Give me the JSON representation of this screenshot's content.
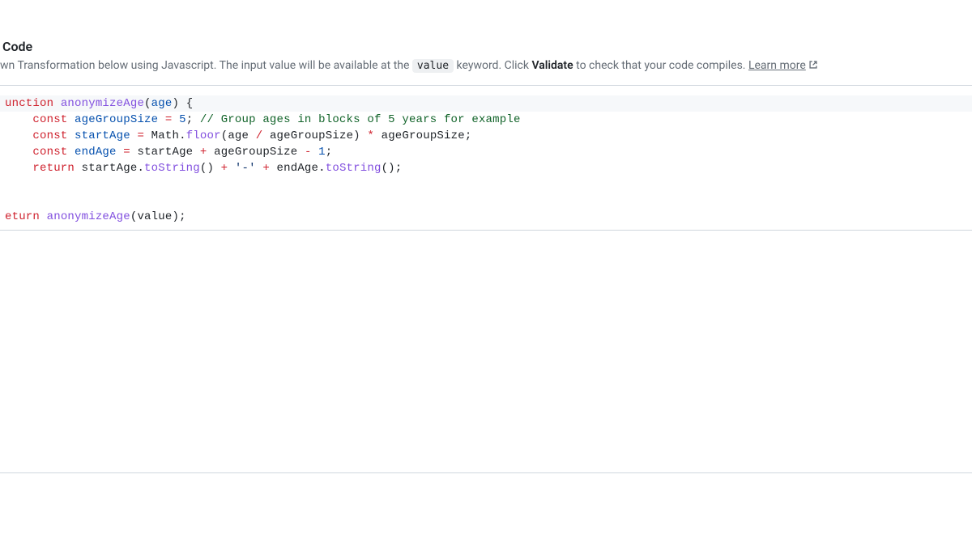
{
  "header": {
    "title": "Code",
    "desc_prefix": "wn Transformation below using Javascript. The input value will be available at the ",
    "desc_keyword": "value",
    "desc_mid": " keyword. Click ",
    "desc_validate": "Validate",
    "desc_suffix": " to check that your code compiles. ",
    "learn_more": "Learn more"
  },
  "code": {
    "l1": {
      "kw": "unction",
      "sp": " ",
      "fn": "anonymizeAge",
      "open": "(",
      "arg": "age",
      "close": ")",
      "sp2": " ",
      "brace": "{"
    },
    "l2": {
      "indent": "    ",
      "kw": "const",
      "sp": " ",
      "var": "ageGroupSize",
      "sp2": " ",
      "op": "=",
      "sp3": " ",
      "num": "5",
      "semi": ";",
      "sp4": " ",
      "comment": "// Group ages in blocks of 5 years for example"
    },
    "l3": {
      "indent": "    ",
      "kw": "const",
      "sp": " ",
      "var": "startAge",
      "sp2": " ",
      "op": "=",
      "sp3": " ",
      "obj": "Math",
      "dot": ".",
      "meth": "floor",
      "open": "(",
      "a1": "age",
      "sp4": " ",
      "div": "/",
      "sp5": " ",
      "a2": "ageGroupSize",
      "close": ")",
      "sp6": " ",
      "mul": "*",
      "sp7": " ",
      "a3": "ageGroupSize",
      "semi": ";"
    },
    "l4": {
      "indent": "    ",
      "kw": "const",
      "sp": " ",
      "var": "endAge",
      "sp2": " ",
      "op": "=",
      "sp3": " ",
      "a1": "startAge",
      "sp4": " ",
      "plus": "+",
      "sp5": " ",
      "a2": "ageGroupSize",
      "sp6": " ",
      "minus": "-",
      "sp7": " ",
      "num": "1",
      "semi": ";"
    },
    "l5": {
      "indent": "    ",
      "kw": "return",
      "sp": " ",
      "a1": "startAge",
      "dot1": ".",
      "m1": "toString",
      "p1": "()",
      "sp2": " ",
      "plus1": "+",
      "sp3": " ",
      "str": "'-'",
      "sp4": " ",
      "plus2": "+",
      "sp5": " ",
      "a2": "endAge",
      "dot2": ".",
      "m2": "toString",
      "p2": "()",
      "semi": ";"
    },
    "l7": {
      "kw": "eturn",
      "sp": " ",
      "fn": "anonymizeAge",
      "open": "(",
      "arg": "value",
      "close": ")",
      "semi": ";"
    }
  }
}
